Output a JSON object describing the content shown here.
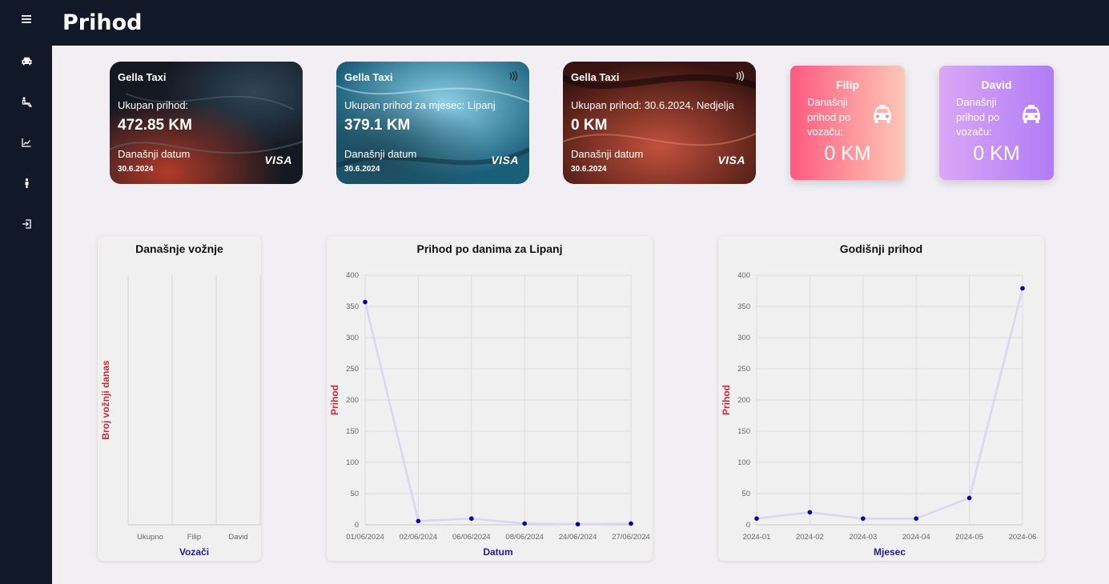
{
  "header": {
    "title": "Prihod"
  },
  "sidebar": {
    "items": [
      {
        "icon": "menu-icon"
      },
      {
        "icon": "car-icon"
      },
      {
        "icon": "driver-seat-icon"
      },
      {
        "icon": "chart-line-icon"
      },
      {
        "icon": "person-icon"
      },
      {
        "icon": "logout-icon"
      }
    ]
  },
  "cards": [
    {
      "brand": "Gella Taxi",
      "label": "Ukupan prihod:",
      "amount": "472.85 KM",
      "date_label": "Današnji datum",
      "date": "30.6.2024",
      "network": "VISA"
    },
    {
      "brand": "Gella Taxi",
      "label": "Ukupan prihod za mjesec: Lipanj",
      "amount": "379.1 KM",
      "date_label": "Današnji datum",
      "date": "30.6.2024",
      "network": "VISA"
    },
    {
      "brand": "Gella Taxi",
      "label": "Ukupan prihod: 30.6.2024, Nedjelja",
      "amount": "0 KM",
      "date_label": "Današnji datum",
      "date": "30.6.2024",
      "network": "VISA"
    }
  ],
  "drivers": [
    {
      "name": "Filip",
      "label": "Današnji prihod po vozaču:",
      "value": "0 KM",
      "icon": "taxi-icon",
      "colors": [
        "#ff5a7e",
        "#fdc8b8"
      ]
    },
    {
      "name": "David",
      "label": "Današnji prihod po vozaču:",
      "value": "0 KM",
      "icon": "taxi-icon",
      "colors": [
        "#dba7f6",
        "#b07cf5"
      ]
    }
  ],
  "colors": {
    "accent": "#111827",
    "axis_title_y": "#cc2a36",
    "axis_title_x": "#1e1e8c",
    "line": "#d8d6f2",
    "point": "#0000a8"
  },
  "chart_data": [
    {
      "type": "bar",
      "title": "Današnje vožnje",
      "xlabel": "Vozači",
      "ylabel": "Broj vožnji danas",
      "categories": [
        "Ukupno",
        "Filip",
        "David"
      ],
      "values": [
        0,
        0,
        0
      ],
      "grid": true
    },
    {
      "type": "line",
      "title": "Prihod po danima za Lipanj",
      "xlabel": "Datum",
      "ylabel": "Prihod",
      "categories": [
        "01/06/2024",
        "02/06/2024",
        "06/06/2024",
        "08/06/2024",
        "24/06/2024",
        "27/06/2024"
      ],
      "values": [
        357,
        6,
        10,
        2,
        1,
        2
      ],
      "ylim": [
        0,
        400
      ],
      "yticks": [
        0,
        50,
        100,
        150,
        200,
        250,
        300,
        350,
        400
      ],
      "grid": true
    },
    {
      "type": "line",
      "title": "Godišnji prihod",
      "xlabel": "Mjesec",
      "ylabel": "Prihod",
      "categories": [
        "2024-01",
        "2024-02",
        "2024-03",
        "2024-04",
        "2024-05",
        "2024-06"
      ],
      "values": [
        10,
        20,
        10,
        10,
        43,
        379
      ],
      "ylim": [
        0,
        400
      ],
      "yticks": [
        0,
        50,
        100,
        150,
        200,
        250,
        300,
        350,
        400
      ],
      "grid": true
    }
  ]
}
